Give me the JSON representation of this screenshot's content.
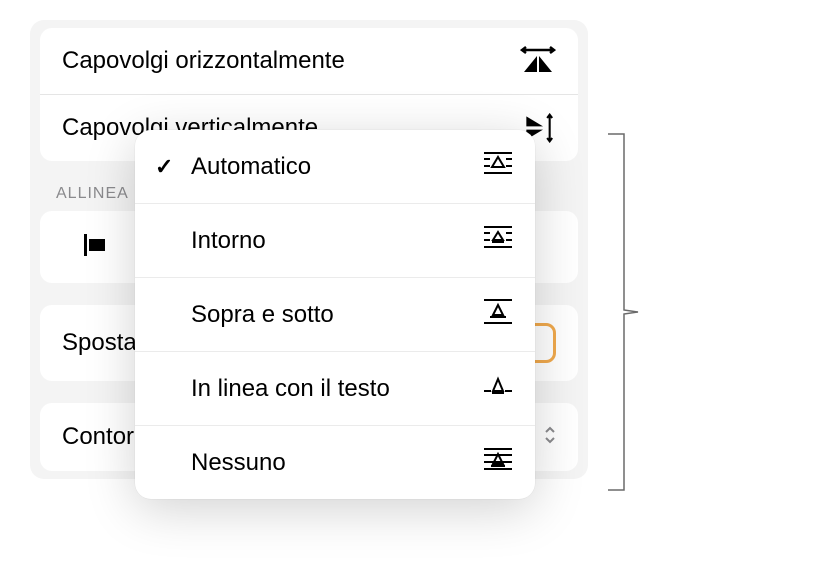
{
  "flip": {
    "horizontal": "Capovolgi orizzontalmente",
    "vertical": "Capovolgi verticalmente"
  },
  "align": {
    "section_label": "ALLINEA"
  },
  "sposta": {
    "label": "Sposta"
  },
  "contorna": {
    "label": "Contorna con testo",
    "value": "Automatico"
  },
  "wrap_popup": {
    "items": [
      {
        "label": "Automatico",
        "selected": true
      },
      {
        "label": "Intorno",
        "selected": false
      },
      {
        "label": "Sopra e sotto",
        "selected": false
      },
      {
        "label": "In linea con il testo",
        "selected": false
      },
      {
        "label": "Nessuno",
        "selected": false
      }
    ]
  }
}
